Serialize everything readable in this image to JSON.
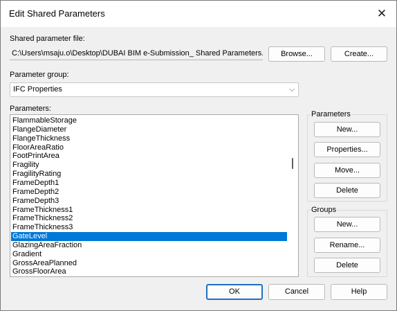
{
  "window": {
    "title": "Edit Shared Parameters",
    "close_icon": "close-icon"
  },
  "shared_file": {
    "label": "Shared parameter file:",
    "path": "C:\\Users\\msaju.o\\Desktop\\DUBAI BIM e-Submission_ Shared Parameters.txt",
    "browse_label": "Browse...",
    "create_label": "Create..."
  },
  "param_group": {
    "label": "Parameter group:",
    "selected": "IFC Properties",
    "dropdown_icon": "chevron-down-icon"
  },
  "parameters": {
    "label": "Parameters:",
    "items": [
      "FlammableStorage",
      "FlangeDiameter",
      "FlangeThickness",
      "FloorAreaRatio",
      "FootPrintArea",
      "Fragility",
      "FragilityRating",
      "FrameDepth1",
      "FrameDepth2",
      "FrameDepth3",
      "FrameThickness1",
      "FrameThickness2",
      "FrameThickness3",
      "GateLevel",
      "GlazingAreaFraction",
      "Gradient",
      "GrossAreaPlanned",
      "GrossFloorArea"
    ],
    "selected_item": "GateLevel"
  },
  "parameters_group": {
    "title": "Parameters",
    "new_label": "New...",
    "properties_label": "Properties...",
    "move_label": "Move...",
    "delete_label": "Delete"
  },
  "groups_group": {
    "title": "Groups",
    "new_label": "New...",
    "rename_label": "Rename...",
    "delete_label": "Delete"
  },
  "footer": {
    "ok_label": "OK",
    "cancel_label": "Cancel",
    "help_label": "Help"
  },
  "colors": {
    "selection": "#0078d7",
    "primary_border": "#1f6fc0",
    "dialog_bg": "#f0f0f0"
  }
}
